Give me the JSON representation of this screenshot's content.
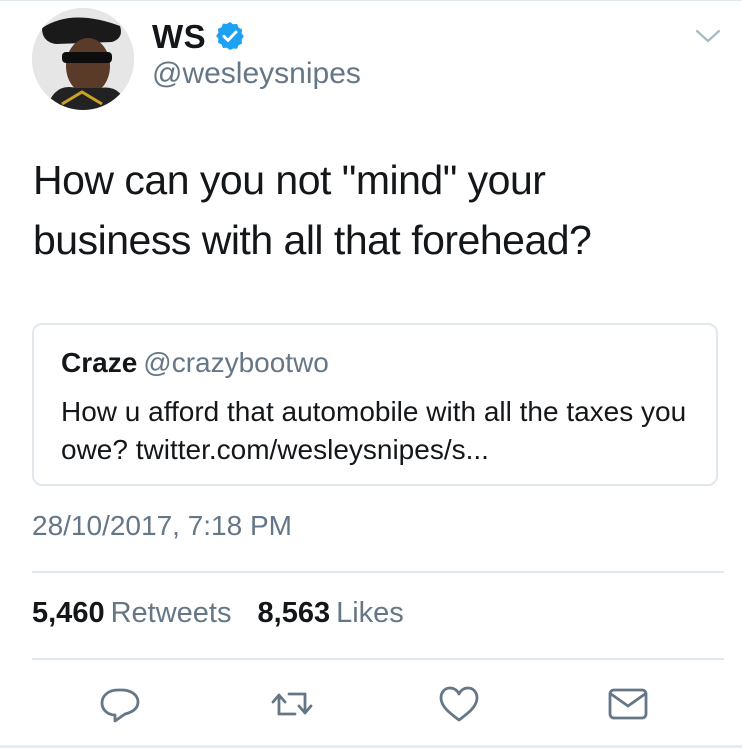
{
  "author": {
    "display_name": "WS",
    "handle": "@wesleysnipes",
    "verified_icon": "verified-badge-icon",
    "verified_color": "#1da1f2"
  },
  "tweet": {
    "text": "How can you not \"mind\" your business with all that forehead?"
  },
  "quoted_tweet": {
    "display_name": "Craze",
    "handle": "@crazybootwo",
    "text": "How u afford that automobile with all the taxes you owe? twitter.com/wesleysnipes/s..."
  },
  "timestamp": "28/10/2017, 7:18 PM",
  "stats": {
    "retweets_count": "5,460",
    "retweets_label": "Retweets",
    "likes_count": "8,563",
    "likes_label": "Likes"
  },
  "actions": [
    "reply-icon",
    "retweet-icon",
    "like-icon",
    "direct-message-icon"
  ],
  "colors": {
    "text": "#14171a",
    "secondary": "#657786",
    "border": "#e1e8ed",
    "icon": "#657786"
  }
}
